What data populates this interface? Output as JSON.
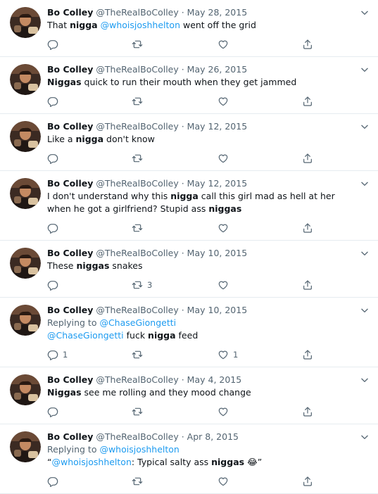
{
  "tweets": [
    {
      "name": "Bo Colley",
      "handle": "@TheRealBoColley",
      "sep": " · ",
      "date": "May 28, 2015",
      "text_parts": [
        {
          "t": "That "
        },
        {
          "t": "nigga",
          "style": "bold"
        },
        {
          "t": " "
        },
        {
          "t": "@whoisjoshhelton",
          "style": "link"
        },
        {
          "t": " went off the grid"
        }
      ],
      "replies": "",
      "retweets": "",
      "likes": ""
    },
    {
      "name": "Bo Colley",
      "handle": "@TheRealBoColley",
      "sep": " · ",
      "date": "May 26, 2015",
      "text_parts": [
        {
          "t": "Niggas",
          "style": "bold"
        },
        {
          "t": " quick to run their mouth when they get jammed"
        }
      ],
      "replies": "",
      "retweets": "",
      "likes": ""
    },
    {
      "name": "Bo Colley",
      "handle": "@TheRealBoColley",
      "sep": " · ",
      "date": "May 12, 2015",
      "text_parts": [
        {
          "t": "Like a "
        },
        {
          "t": "nigga",
          "style": "bold"
        },
        {
          "t": " don't know"
        }
      ],
      "replies": "",
      "retweets": "",
      "likes": ""
    },
    {
      "name": "Bo Colley",
      "handle": "@TheRealBoColley",
      "sep": " · ",
      "date": "May 12, 2015",
      "text_parts": [
        {
          "t": "I don't understand why this "
        },
        {
          "t": "nigga",
          "style": "bold"
        },
        {
          "t": " call this girl mad as hell at her when he got a girlfriend? Stupid ass "
        },
        {
          "t": "niggas",
          "style": "bold"
        }
      ],
      "replies": "",
      "retweets": "",
      "likes": ""
    },
    {
      "name": "Bo Colley",
      "handle": "@TheRealBoColley",
      "sep": " · ",
      "date": "May 10, 2015",
      "text_parts": [
        {
          "t": "These "
        },
        {
          "t": "niggas",
          "style": "bold"
        },
        {
          "t": " snakes"
        }
      ],
      "replies": "",
      "retweets": "3",
      "likes": ""
    },
    {
      "name": "Bo Colley",
      "handle": "@TheRealBoColley",
      "sep": " · ",
      "date": "May 10, 2015",
      "replying_prefix": "Replying to ",
      "replying_to": "@ChaseGiongetti",
      "text_parts": [
        {
          "t": "@ChaseGiongetti",
          "style": "link"
        },
        {
          "t": " fuck "
        },
        {
          "t": "nigga",
          "style": "bold"
        },
        {
          "t": " feed"
        }
      ],
      "replies": "1",
      "retweets": "",
      "likes": "1"
    },
    {
      "name": "Bo Colley",
      "handle": "@TheRealBoColley",
      "sep": " · ",
      "date": "May 4, 2015",
      "text_parts": [
        {
          "t": "Niggas",
          "style": "bold"
        },
        {
          "t": " see me rolling and they mood change"
        }
      ],
      "replies": "",
      "retweets": "",
      "likes": ""
    },
    {
      "name": "Bo Colley",
      "handle": "@TheRealBoColley",
      "sep": " · ",
      "date": "Apr 8, 2015",
      "replying_prefix": "Replying to ",
      "replying_to": "@whoisjoshhelton",
      "text_parts": [
        {
          "t": "“"
        },
        {
          "t": "@whoisjoshhelton",
          "style": "link"
        },
        {
          "t": ": Typical salty ass "
        },
        {
          "t": "niggas",
          "style": "bold"
        },
        {
          "t": " 😂"
        },
        {
          "t": "”"
        }
      ],
      "replies": "",
      "retweets": "",
      "likes": ""
    }
  ],
  "colors": {
    "text": "#0f1419",
    "secondary": "#536471",
    "link": "#1d9bf0",
    "divider": "#e6ecf0"
  },
  "icons": {
    "reply": "reply-icon",
    "retweet": "retweet-icon",
    "like": "heart-icon",
    "share": "share-icon",
    "caret": "chevron-down-icon"
  }
}
